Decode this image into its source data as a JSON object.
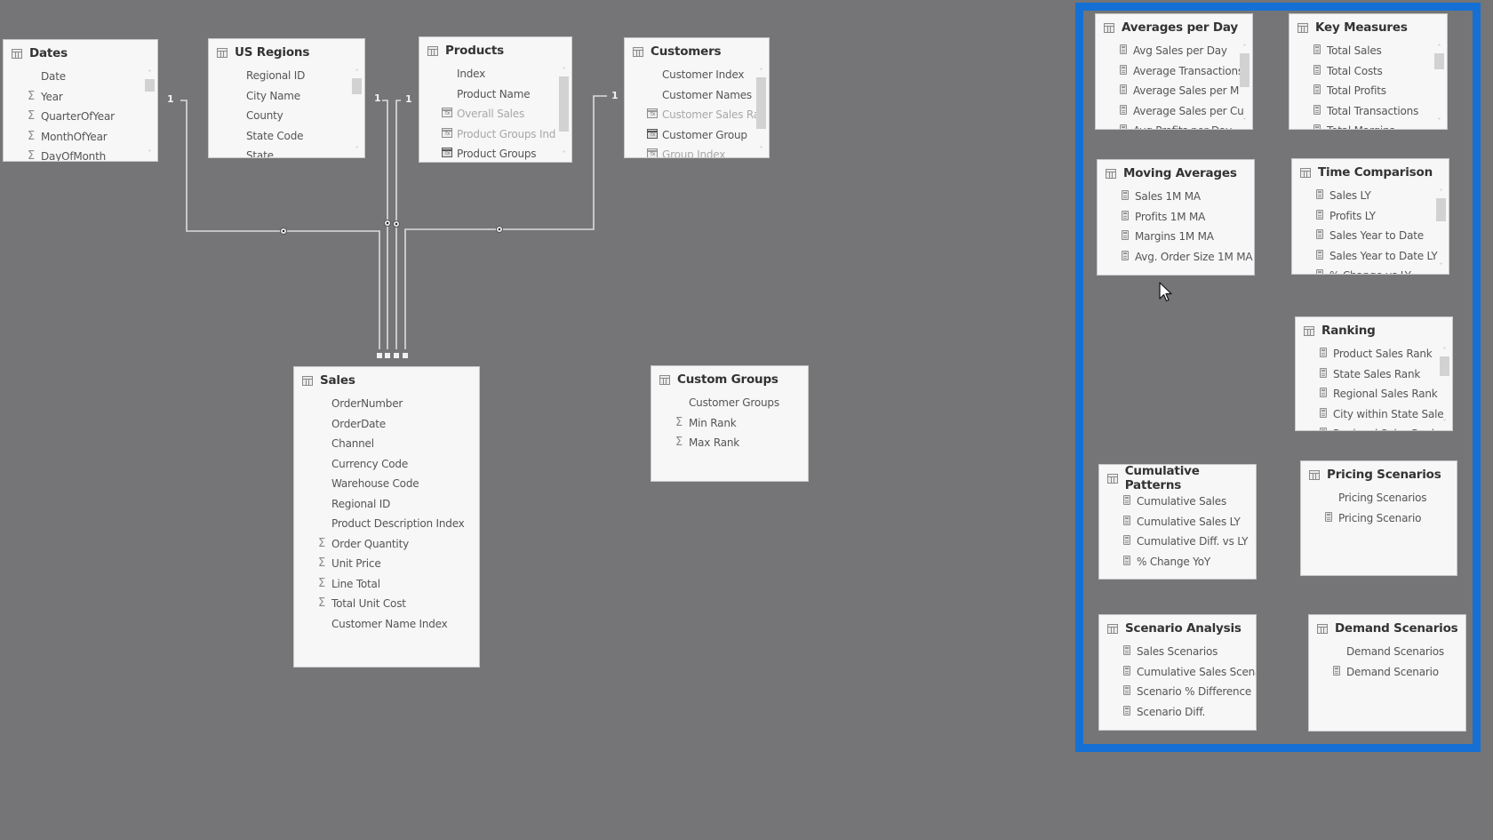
{
  "colors": {
    "canvas": "#757577",
    "card": "#f7f7f7",
    "selection_border": "#1470d4",
    "connector": "#dcdcdc"
  },
  "tables": {
    "dates": {
      "title": "Dates",
      "fields": [
        {
          "name": "Date",
          "icon": "none"
        },
        {
          "name": "Year",
          "icon": "sigma"
        },
        {
          "name": "QuarterOfYear",
          "icon": "sigma"
        },
        {
          "name": "MonthOfYear",
          "icon": "sigma"
        },
        {
          "name": "DayOfMonth",
          "icon": "sigma"
        }
      ]
    },
    "us_regions": {
      "title": "US Regions",
      "fields": [
        {
          "name": "Regional ID",
          "icon": "none"
        },
        {
          "name": "City Name",
          "icon": "none"
        },
        {
          "name": "County",
          "icon": "none"
        },
        {
          "name": "State Code",
          "icon": "none"
        },
        {
          "name": "State",
          "icon": "none"
        }
      ]
    },
    "products": {
      "title": "Products",
      "fields": [
        {
          "name": "Index",
          "icon": "none"
        },
        {
          "name": "Product Name",
          "icon": "none"
        },
        {
          "name": "Overall Sales",
          "icon": "calc-column-hidden"
        },
        {
          "name": "Product Groups Ind",
          "icon": "calc-column-hidden"
        },
        {
          "name": "Product Groups",
          "icon": "calc-column"
        }
      ]
    },
    "customers": {
      "title": "Customers",
      "fields": [
        {
          "name": "Customer Index",
          "icon": "none"
        },
        {
          "name": "Customer Names",
          "icon": "none"
        },
        {
          "name": "Customer Sales Ra",
          "icon": "calc-column-hidden"
        },
        {
          "name": "Customer Group",
          "icon": "calc-column"
        },
        {
          "name": "Group Index",
          "icon": "calc-column-hidden"
        }
      ]
    },
    "sales": {
      "title": "Sales",
      "fields": [
        {
          "name": "OrderNumber",
          "icon": "none"
        },
        {
          "name": "OrderDate",
          "icon": "none"
        },
        {
          "name": "Channel",
          "icon": "none"
        },
        {
          "name": "Currency Code",
          "icon": "none"
        },
        {
          "name": "Warehouse Code",
          "icon": "none"
        },
        {
          "name": "Regional ID",
          "icon": "none"
        },
        {
          "name": "Product Description Index",
          "icon": "none"
        },
        {
          "name": "Order Quantity",
          "icon": "sigma"
        },
        {
          "name": "Unit Price",
          "icon": "sigma"
        },
        {
          "name": "Line Total",
          "icon": "sigma"
        },
        {
          "name": "Total Unit Cost",
          "icon": "sigma"
        },
        {
          "name": "Customer Name Index",
          "icon": "none"
        }
      ]
    },
    "custom_groups": {
      "title": "Custom Groups",
      "fields": [
        {
          "name": "Customer Groups",
          "icon": "none"
        },
        {
          "name": "Min Rank",
          "icon": "sigma"
        },
        {
          "name": "Max Rank",
          "icon": "sigma"
        }
      ]
    },
    "averages_per_day": {
      "title": "Averages per Day",
      "fields": [
        {
          "name": "Avg Sales per Day",
          "icon": "measure"
        },
        {
          "name": "Average Transactions",
          "icon": "measure"
        },
        {
          "name": "Average Sales per M",
          "icon": "measure"
        },
        {
          "name": "Average Sales per Cu",
          "icon": "measure"
        },
        {
          "name": "Avg Profits per Day",
          "icon": "measure"
        }
      ]
    },
    "key_measures": {
      "title": "Key Measures",
      "fields": [
        {
          "name": "Total Sales",
          "icon": "measure"
        },
        {
          "name": "Total Costs",
          "icon": "measure"
        },
        {
          "name": "Total Profits",
          "icon": "measure"
        },
        {
          "name": "Total Transactions",
          "icon": "measure"
        },
        {
          "name": "Total Margins",
          "icon": "measure"
        }
      ]
    },
    "moving_averages": {
      "title": "Moving Averages",
      "fields": [
        {
          "name": "Sales 1M MA",
          "icon": "measure"
        },
        {
          "name": "Profits 1M MA",
          "icon": "measure"
        },
        {
          "name": "Margins 1M MA",
          "icon": "measure"
        },
        {
          "name": "Avg. Order Size 1M MA",
          "icon": "measure"
        }
      ]
    },
    "time_comparison": {
      "title": "Time Comparison",
      "fields": [
        {
          "name": "Sales LY",
          "icon": "measure"
        },
        {
          "name": "Profits LY",
          "icon": "measure"
        },
        {
          "name": "Sales Year to Date",
          "icon": "measure"
        },
        {
          "name": "Sales Year to Date LY",
          "icon": "measure"
        },
        {
          "name": "% Change vs LY",
          "icon": "measure"
        }
      ]
    },
    "ranking": {
      "title": "Ranking",
      "fields": [
        {
          "name": "Product Sales Rank",
          "icon": "measure"
        },
        {
          "name": "State Sales Rank",
          "icon": "measure"
        },
        {
          "name": "Regional Sales Rank",
          "icon": "measure"
        },
        {
          "name": "City within State Sale",
          "icon": "measure"
        },
        {
          "name": "Regional Sales Rank",
          "icon": "measure"
        }
      ]
    },
    "cumulative_patterns": {
      "title": "Cumulative Patterns",
      "fields": [
        {
          "name": "Cumulative Sales",
          "icon": "measure"
        },
        {
          "name": "Cumulative Sales LY",
          "icon": "measure"
        },
        {
          "name": "Cumulative Diff. vs LY",
          "icon": "measure"
        },
        {
          "name": "% Change YoY",
          "icon": "measure"
        }
      ]
    },
    "pricing_scenarios": {
      "title": "Pricing Scenarios",
      "fields": [
        {
          "name": "Pricing Scenarios",
          "icon": "none"
        },
        {
          "name": "Pricing Scenario",
          "icon": "measure"
        }
      ]
    },
    "scenario_analysis": {
      "title": "Scenario Analysis",
      "fields": [
        {
          "name": "Sales Scenarios",
          "icon": "measure"
        },
        {
          "name": "Cumulative Sales Scena",
          "icon": "measure"
        },
        {
          "name": "Scenario % Difference",
          "icon": "measure"
        },
        {
          "name": "Scenario Diff.",
          "icon": "measure"
        }
      ]
    },
    "demand_scenarios": {
      "title": "Demand Scenarios",
      "fields": [
        {
          "name": "Demand Scenarios",
          "icon": "none"
        },
        {
          "name": "Demand Scenario",
          "icon": "measure"
        }
      ]
    }
  },
  "relationships": [
    {
      "from": "Dates",
      "to": "Sales",
      "from_cardinality": "1",
      "to_cardinality": "*"
    },
    {
      "from": "US Regions",
      "to": "Sales",
      "from_cardinality": "1",
      "to_cardinality": "*"
    },
    {
      "from": "Products",
      "to": "Sales",
      "from_cardinality": "1",
      "to_cardinality": "*"
    },
    {
      "from": "Customers",
      "to": "Sales",
      "from_cardinality": "1",
      "to_cardinality": "*"
    }
  ]
}
